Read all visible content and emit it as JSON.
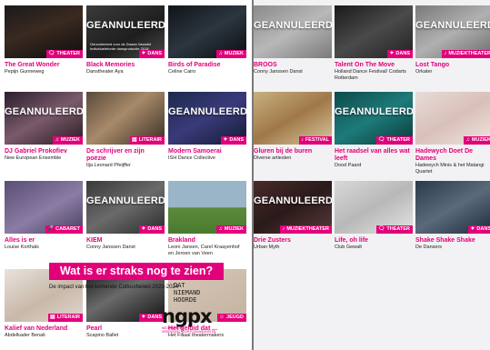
{
  "cancel_label": "GEANNULEERD?",
  "accent_color": "#e2007a",
  "cards": [
    {
      "title": "The Great Wonder",
      "subtitle": "Pepijn Gunneweg",
      "tag": "THEATER",
      "icon": "speech-bubble-icon",
      "glyph": "🗨",
      "cancelled": false,
      "bg": "linear-gradient(160deg,#1a1a1a 0%,#3a2a20 45%,#0d0d0d 100%)"
    },
    {
      "title": "Black Memories",
      "subtitle": "Danstheater Aya",
      "note": "Genomineerd voor de Zwaan Vaandel Individueleforde dansproductie 2018",
      "tag": "DANS",
      "icon": "dancer-icon",
      "glyph": "✦",
      "cancelled": true,
      "bg": "linear-gradient(150deg,#3a3a3a 0%,#1e1e1e 60%,#4a4a4a 100%)"
    },
    {
      "title": "Birds of Paradise",
      "subtitle": "Celine Cairo",
      "tag": "MUZIEK",
      "icon": "music-note-icon",
      "glyph": "♫",
      "cancelled": false,
      "bg": "linear-gradient(150deg,#101418 0%,#2c3640 50%,#0a0d10 100%)"
    },
    {
      "title": "DJ Gabriel Prokofiev",
      "subtitle": "New European Ensemble",
      "tag": "MUZIEK",
      "icon": "music-note-icon",
      "glyph": "♫",
      "cancelled": true,
      "bg": "linear-gradient(150deg,#2a1e2e 0%,#7a5a6a 50%,#2a1a22 100%)"
    },
    {
      "title": "De schrijver en zijn poëzie",
      "subtitle": "Ilja Leonard Pfeijffer",
      "tag": "LITERAIR",
      "icon": "book-icon",
      "glyph": "▤",
      "cancelled": false,
      "bg": "linear-gradient(140deg,#5a4a3a 0%,#a88a6a 45%,#3a2e24 100%)"
    },
    {
      "title": "Modern Samoerai",
      "subtitle": "ISH Dance Collective",
      "tag": "DANS",
      "icon": "dancer-icon",
      "glyph": "✦",
      "cancelled": true,
      "bg": "linear-gradient(150deg,#1c2a4a 0%,#3a3a7a 50%,#141a30 100%)"
    },
    {
      "title": "Alles is er",
      "subtitle": "Louise Korthals",
      "tag": "CABARET",
      "icon": "microphone-icon",
      "glyph": "🎤",
      "cancelled": false,
      "bg": "linear-gradient(150deg,#5a4e74 0%,#8a7ca4 55%,#4a405e 100%)"
    },
    {
      "title": "KIEM",
      "subtitle": "Conny Janssen Danst",
      "tag": "DANS",
      "icon": "dancer-icon",
      "glyph": "✦",
      "cancelled": true,
      "bg": "linear-gradient(150deg,#3a3a3a 0%,#6a6a6a 50%,#2a2a2a 100%)"
    },
    {
      "title": "Brakland",
      "subtitle": "Leoni Jansen, Carel Kraayenhof en Jeroen van Veen",
      "tag": "MUZIEK",
      "icon": "music-note-icon",
      "glyph": "♫",
      "cancelled": false,
      "bg": "linear-gradient(180deg,#9ab4c8 0%,#9ab4c8 50%,#5a8a3a 51%,#4a7a2e 100%)"
    },
    {
      "title": "Kalief van Nederland",
      "subtitle": "Abdelkader Benali",
      "tag": "LITERAIR",
      "icon": "book-icon",
      "glyph": "▤",
      "cancelled": false,
      "bg": "linear-gradient(150deg,#e8e2dc 0%,#c8b8a8 55%,#e0d8d0 100%)"
    },
    {
      "title": "Pearl",
      "subtitle": "Scapino Ballet",
      "tag": "DANS",
      "icon": "dancer-icon",
      "glyph": "✦",
      "cancelled": false,
      "bg": "linear-gradient(150deg,#1a1a1a 0%,#6a6a6a 45%,#111111 100%)"
    },
    {
      "title": "Het geluid dat ...",
      "subtitle": "Het Filiaal theatermakers",
      "tag": "JEUGD",
      "icon": "child-icon",
      "glyph": "☺",
      "cancelled": false,
      "bg": "linear-gradient(150deg,#d8c8b8 0%,#c4b2a0 100%)",
      "poster": "HET GELUID DAT NIEMAND HOORDE"
    },
    {
      "title": "BROOS",
      "subtitle": "Conny Janssen Danst",
      "tag": "",
      "icon": "",
      "glyph": "",
      "cancelled": true,
      "bg": "linear-gradient(150deg,#8a8a8a 0%,#b8b8b8 50%,#7a7a7a 100%)"
    },
    {
      "title": "Talent On The Move",
      "subtitle": "Holland Dance Festival/ Codarts Rotterdam",
      "tag": "DANS",
      "icon": "dancer-icon",
      "glyph": "✦",
      "cancelled": false,
      "bg": "linear-gradient(150deg,#1a1a1a 0%,#4a4a4a 50%,#222222 100%)"
    },
    {
      "title": "Lost Tango",
      "subtitle": "Orkater",
      "tag": "MUZIEKTHEATER",
      "icon": "music-theater-icon",
      "glyph": "♪",
      "cancelled": true,
      "bg": "linear-gradient(150deg,#7a7a7a 0%,#b0b0b0 50%,#6a6a6a 100%)"
    },
    {
      "title": "Gluren bij de buren",
      "subtitle": "Diverse artiesten",
      "tag": "FESTIVAL",
      "icon": "festival-icon",
      "glyph": "♪",
      "cancelled": false,
      "bg": "linear-gradient(150deg,#c8b080 0%,#a07848 50%,#d8c8a0 100%)"
    },
    {
      "title": "Het raadsel van alles wat leeft",
      "subtitle": "Dood Paard",
      "tag": "THEATER",
      "icon": "speech-bubble-icon",
      "glyph": "🗨",
      "cancelled": true,
      "bg": "linear-gradient(150deg,#0e4a4a 0%,#1e7a7a 50%,#0a3a3a 100%)"
    },
    {
      "title": "Hadewych Doet De Dames",
      "subtitle": "Hadewych Minis & het Matangi Quartet",
      "tag": "MUZIEK",
      "icon": "music-note-icon",
      "glyph": "♫",
      "cancelled": false,
      "bg": "linear-gradient(150deg,#e8dcd8 0%,#d8c0b8 50%,#f0e6e2 100%)"
    },
    {
      "title": "Drie Zusters",
      "subtitle": "Urban Myth",
      "tag": "MUZIEKTHEATER",
      "icon": "music-theater-icon",
      "glyph": "♪",
      "cancelled": true,
      "bg": "linear-gradient(150deg,#4a2a2a 0%,#2a1a1a 50%,#5a3a3a 100%)"
    },
    {
      "title": "Life, oh life",
      "subtitle": "Club Gewalt",
      "tag": "THEATER",
      "icon": "speech-bubble-icon",
      "glyph": "🗨",
      "cancelled": false,
      "bg": "linear-gradient(150deg,#d8d8d8 0%,#b8b8b8 50%,#e4e4e4 100%)"
    },
    {
      "title": "Shake Shake Shake",
      "subtitle": "De Dansers",
      "tag": "DANS",
      "icon": "dancer-icon",
      "glyph": "✦",
      "cancelled": false,
      "bg": "linear-gradient(150deg,#2a3a4a 0%,#5a6a7a 50%,#1a2a3a 100%)"
    }
  ],
  "promo": {
    "heading": "Wat is er straks nog te zien?",
    "subheading": "De impact van het komende Cultuurbeleid 2021-2024"
  },
  "logo": {
    "word": "ngpx",
    "line1": "NEDERLANDSE",
    "line2": "VERENIGING VOOR PODIUMKUNSTEN"
  }
}
